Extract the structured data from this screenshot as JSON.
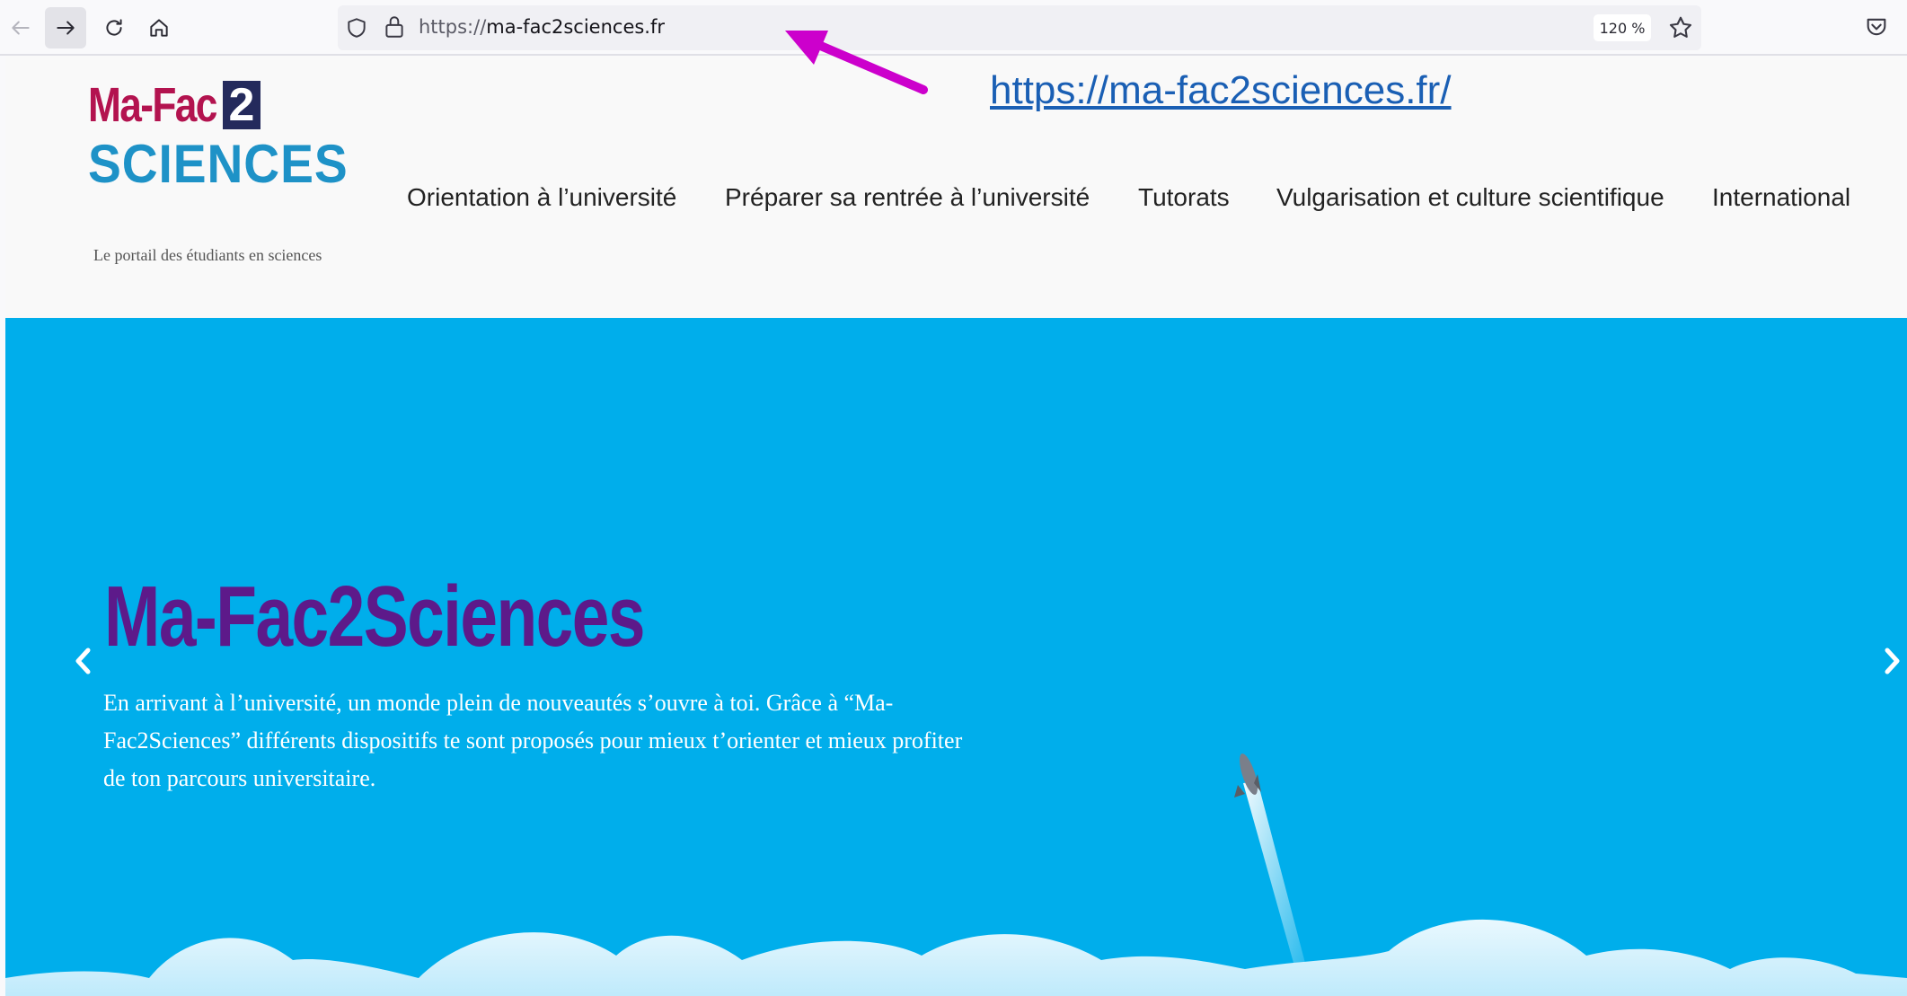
{
  "browser": {
    "url_scheme": "https://",
    "url_host": "ma-fac2sciences.fr",
    "zoom": "120 %"
  },
  "annotation": {
    "link_text": "https://ma-fac2sciences.fr/",
    "arrow_color": "#cc00cc"
  },
  "logo": {
    "line1": "Ma-Fac",
    "badge": "2",
    "line2": "SCIENCES",
    "tagline": "Le portail des étudiants en sciences"
  },
  "nav": {
    "items": [
      "Orientation à l’université",
      "Préparer sa rentrée à l’université",
      "Tutorats",
      "Vulgarisation et culture scientifique",
      "International"
    ]
  },
  "hero": {
    "title": "Ma-Fac2Sciences",
    "text": "En arrivant à l’université, un monde plein de nouveautés s’ouvre à toi. Grâce à “Ma-Fac2Sciences” différents dispositifs te sont proposés pour mieux t’orienter et mieux profiter de ton parcours universitaire.",
    "background_color": "#00aeeb",
    "title_color": "#5d1a8a"
  },
  "icons": {
    "back": "arrow-left-icon",
    "forward": "arrow-right-icon",
    "reload": "reload-icon",
    "home": "home-icon",
    "tracking": "shield-icon",
    "secure": "lock-icon",
    "bookmark": "star-icon",
    "pocket": "pocket-icon",
    "prev": "chevron-left-icon",
    "next": "chevron-right-icon"
  }
}
